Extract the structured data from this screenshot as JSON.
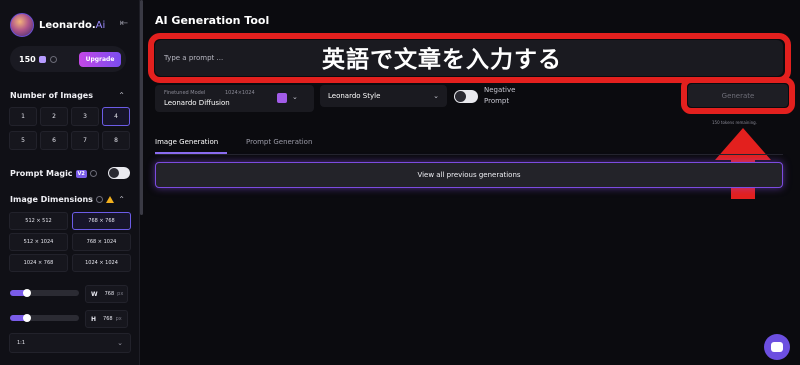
{
  "brand": {
    "name": "Leonardo.",
    "suffix": "Ai"
  },
  "tokens": {
    "count": "150",
    "upgrade_label": "Upgrade"
  },
  "sidebar": {
    "num_images_title": "Number of Images",
    "num_options": [
      "1",
      "2",
      "3",
      "4",
      "5",
      "6",
      "7",
      "8"
    ],
    "num_selected": "4",
    "prompt_magic_title": "Prompt Magic",
    "prompt_magic_badge": "V2",
    "image_dimensions_title": "Image Dimensions",
    "dimension_options": [
      "512 × 512",
      "768 × 768",
      "512 × 1024",
      "768 × 1024",
      "1024 × 768",
      "1024 × 1024"
    ],
    "dimension_selected": "768 × 768",
    "width": {
      "letter": "W",
      "value": "768",
      "unit": "px"
    },
    "height": {
      "letter": "H",
      "value": "768",
      "unit": "px"
    },
    "width_slider_level": 0.25,
    "height_slider_level": 0.25,
    "aspect_ratio": "1:1"
  },
  "main": {
    "title": "AI Generation Tool",
    "prompt_placeholder": "Type a prompt ...",
    "overlay_caption": "英語で文章を入力する",
    "model": {
      "label": "Finetuned Model",
      "resolution": "1024×1024",
      "name": "Leonardo Diffusion"
    },
    "style": "Leonardo Style",
    "negative_prompt_label_1": "Negative",
    "negative_prompt_label_2": "Prompt",
    "generate_label": "Generate",
    "tokens_remaining": "150 tokens remaining.",
    "tabs": [
      {
        "label": "Image Generation",
        "active": true
      },
      {
        "label": "Prompt Generation",
        "active": false
      }
    ],
    "view_all_label": "View all previous generations"
  },
  "colors": {
    "accent": "#7a5ce8",
    "annotation_red": "#e3201e",
    "background": "#0b0b0f"
  }
}
